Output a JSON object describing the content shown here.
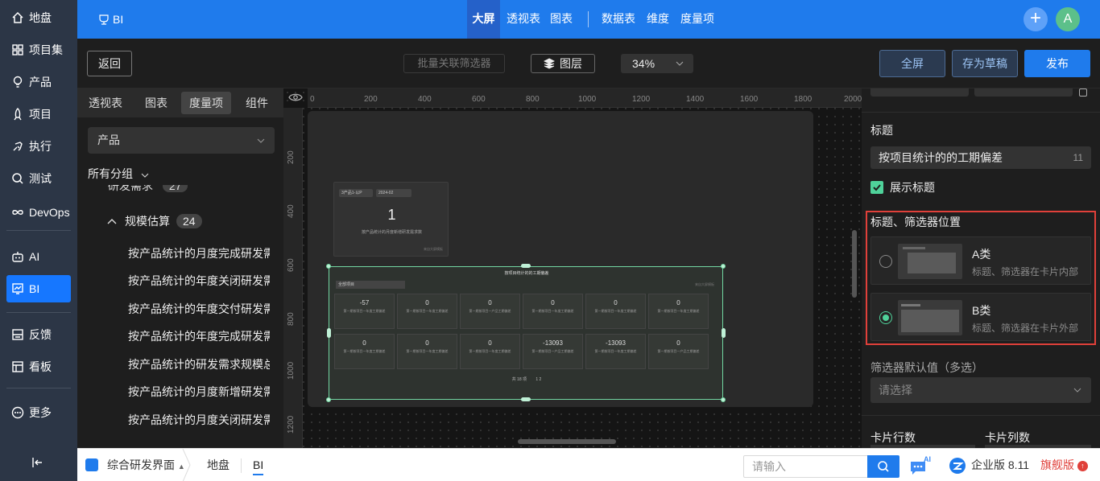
{
  "nav": {
    "items": [
      {
        "label": "地盘",
        "icon": "home-icon"
      },
      {
        "label": "项目集",
        "icon": "grid-icon"
      },
      {
        "label": "产品",
        "icon": "bulb-icon"
      },
      {
        "label": "项目",
        "icon": "rocket-icon"
      },
      {
        "label": "执行",
        "icon": "run-icon"
      },
      {
        "label": "测试",
        "icon": "search-icon"
      },
      {
        "label": "DevOps",
        "icon": "infinity-icon"
      },
      {
        "label": "AI",
        "icon": "robot-icon"
      },
      {
        "label": "BI",
        "icon": "chart-icon"
      },
      {
        "label": "反馈",
        "icon": "feedback-icon"
      },
      {
        "label": "看板",
        "icon": "board-icon"
      },
      {
        "label": "更多",
        "icon": "more-icon"
      }
    ],
    "collapse_icon": "collapse-icon"
  },
  "topbar": {
    "logo": "BI",
    "tabs": [
      "大屏",
      "透视表",
      "图表",
      "数据表",
      "维度",
      "度量项"
    ],
    "avatar": "A"
  },
  "toolbar": {
    "back": "返回",
    "batch_filter": "批量关联筛选器",
    "layers": "图层",
    "zoom": "34%",
    "fullscreen": "全屏",
    "save_draft": "存为草稿",
    "publish": "发布"
  },
  "left_panel": {
    "tabs": [
      "透视表",
      "图表",
      "度量项",
      "组件"
    ],
    "select_value": "产品",
    "group_label": "所有分组",
    "partial_row": "研发需求",
    "partial_count": "27",
    "subgroup": {
      "label": "规模估算",
      "count": "24"
    },
    "items": [
      "按产品统计的月度完成研发需求规模数",
      "按产品统计的年度关闭研发需求规模数",
      "按产品统计的年度交付研发需求规模数",
      "按产品统计的年度完成研发需求规模数",
      "按产品统计的研发需求规模总数",
      "按产品统计的月度新增研发需求规模数",
      "按产品统计的月度关闭研发需求规模数"
    ]
  },
  "canvas": {
    "ruler_h": [
      "0",
      "200",
      "400",
      "600",
      "800",
      "1000",
      "1200",
      "1400",
      "1600",
      "1800",
      "2000"
    ],
    "ruler_v": [
      "200",
      "400",
      "600",
      "800",
      "1000",
      "1200"
    ],
    "card1": {
      "filter1": "3产品1-以P",
      "filter2": "2024-02",
      "value": "1",
      "label": "按产品统计的月度新增研发需求数",
      "source": "来自大屏模板"
    },
    "card2": {
      "title": "按项目统计的的工期偏差",
      "filter": "全部项目",
      "source": "来自大屏模板",
      "kpis": [
        {
          "value": "-57",
          "label": "第一期按项目一年度工期偏差"
        },
        {
          "value": "0",
          "label": "第一期按项目一年度工期偏差"
        },
        {
          "value": "0",
          "label": "第一期按项目一产品工期偏差"
        },
        {
          "value": "0",
          "label": "第一期按项目一年度工期偏差"
        },
        {
          "value": "0",
          "label": "第一期按项目一年度工期偏差"
        },
        {
          "value": "0",
          "label": "第一期按项目一年度工期偏差"
        },
        {
          "value": "0",
          "label": "第一期按项目一年度工期偏差"
        },
        {
          "value": "0",
          "label": "第一期按项目一年度工期偏差"
        },
        {
          "value": "0",
          "label": "第一期按项目一年度工期偏差"
        },
        {
          "value": "-13093",
          "label": "第一期按项目一产品工期偏差"
        },
        {
          "value": "-13093",
          "label": "第一期按项目一年度工期偏差"
        },
        {
          "value": "0",
          "label": "第一期按项目一产品工期偏差"
        }
      ],
      "pager": "共 18 项",
      "pager_pages": "1  2"
    }
  },
  "right_panel": {
    "title_label": "标题",
    "title_value": "按项目统计的的工期偏差",
    "title_count": "11",
    "show_title": "展示标题",
    "position_label": "标题、筛选器位置",
    "options": [
      {
        "name": "A类",
        "desc": "标题、筛选器在卡片内部",
        "selected": false
      },
      {
        "name": "B类",
        "desc": "标题、筛选器在卡片外部",
        "selected": true
      }
    ],
    "filter_default_label": "筛选器默认值（多选）",
    "filter_placeholder": "请选择",
    "rows_label": "卡片行数",
    "cols_label": "卡片列数"
  },
  "bottombar": {
    "workspace": "综合研发界面",
    "crumbs": [
      "地盘",
      "BI"
    ],
    "search_placeholder": "请输入",
    "ai_badge": "AI",
    "edition": "企业版 8.11",
    "flagship": "旗舰版"
  },
  "colors": {
    "accent": "#1f7bec",
    "green": "#4fd29a",
    "highlight": "#e0403a"
  }
}
